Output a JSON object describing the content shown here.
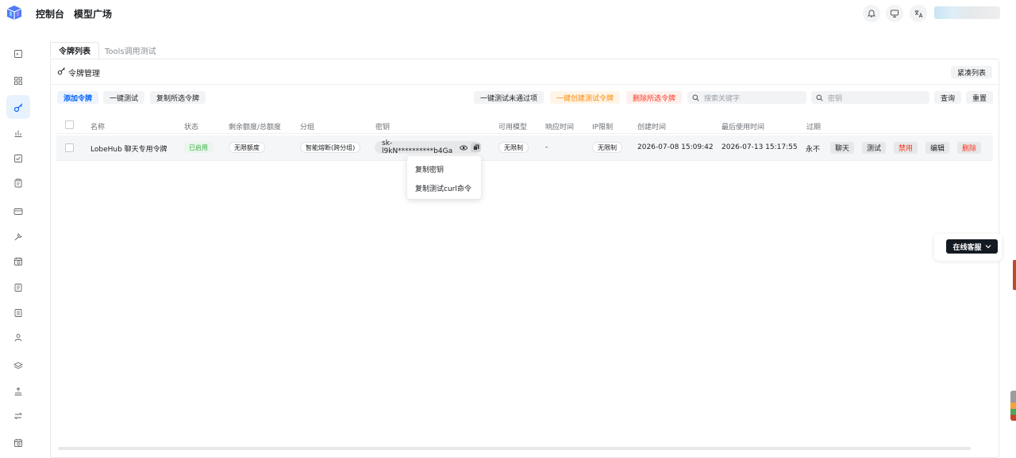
{
  "topnav": {
    "console": "控制台",
    "models": "模型广场"
  },
  "tabs": [
    {
      "label": "令牌列表"
    },
    {
      "label": "Tools调用测试"
    }
  ],
  "card": {
    "title": "令牌管理",
    "compact_label": "紧凑列表"
  },
  "toolbar": {
    "add": "添加令牌",
    "test_all": "一键测试",
    "copy_selected": "复制所选令牌",
    "test_failed": "一键测试未通过项",
    "create_test": "一键创建测试令牌",
    "delete_selected": "删除所选令牌",
    "search_placeholder": "搜索关键字",
    "key_placeholder": "密钥",
    "query": "查询",
    "reset": "重置"
  },
  "table": {
    "columns": [
      "名称",
      "状态",
      "剩余额度/总额度",
      "分组",
      "密钥",
      "可用模型",
      "响应时间",
      "IP限制",
      "创建时间",
      "最后使用时间",
      "过期"
    ],
    "rows": [
      {
        "name": "LobeHub 聊天专用令牌",
        "status": "已启用",
        "quota": "无限额度",
        "group": "智能熔断(跨分组)",
        "key": "sk-l9kN**********b4Ga",
        "models": "无限制",
        "response_time": "-",
        "ip_limit": "无限制",
        "created": "2026-07-08 15:09:42",
        "last_used": "2026-07-13 15:17:55",
        "expire": "永不",
        "actions": {
          "chat": "聊天",
          "test": "测试",
          "disable": "禁用",
          "edit": "编辑",
          "delete": "删除"
        }
      }
    ]
  },
  "dropdown": {
    "copy_key": "复制密钥",
    "copy_curl": "复制测试curl命令"
  },
  "support": {
    "label": "在线客服"
  },
  "colors": {
    "primary": "#0064fa",
    "orange": "#fc8800",
    "red": "#f93920",
    "green": "#3bb346",
    "active_bg": "#e8f2fe"
  }
}
